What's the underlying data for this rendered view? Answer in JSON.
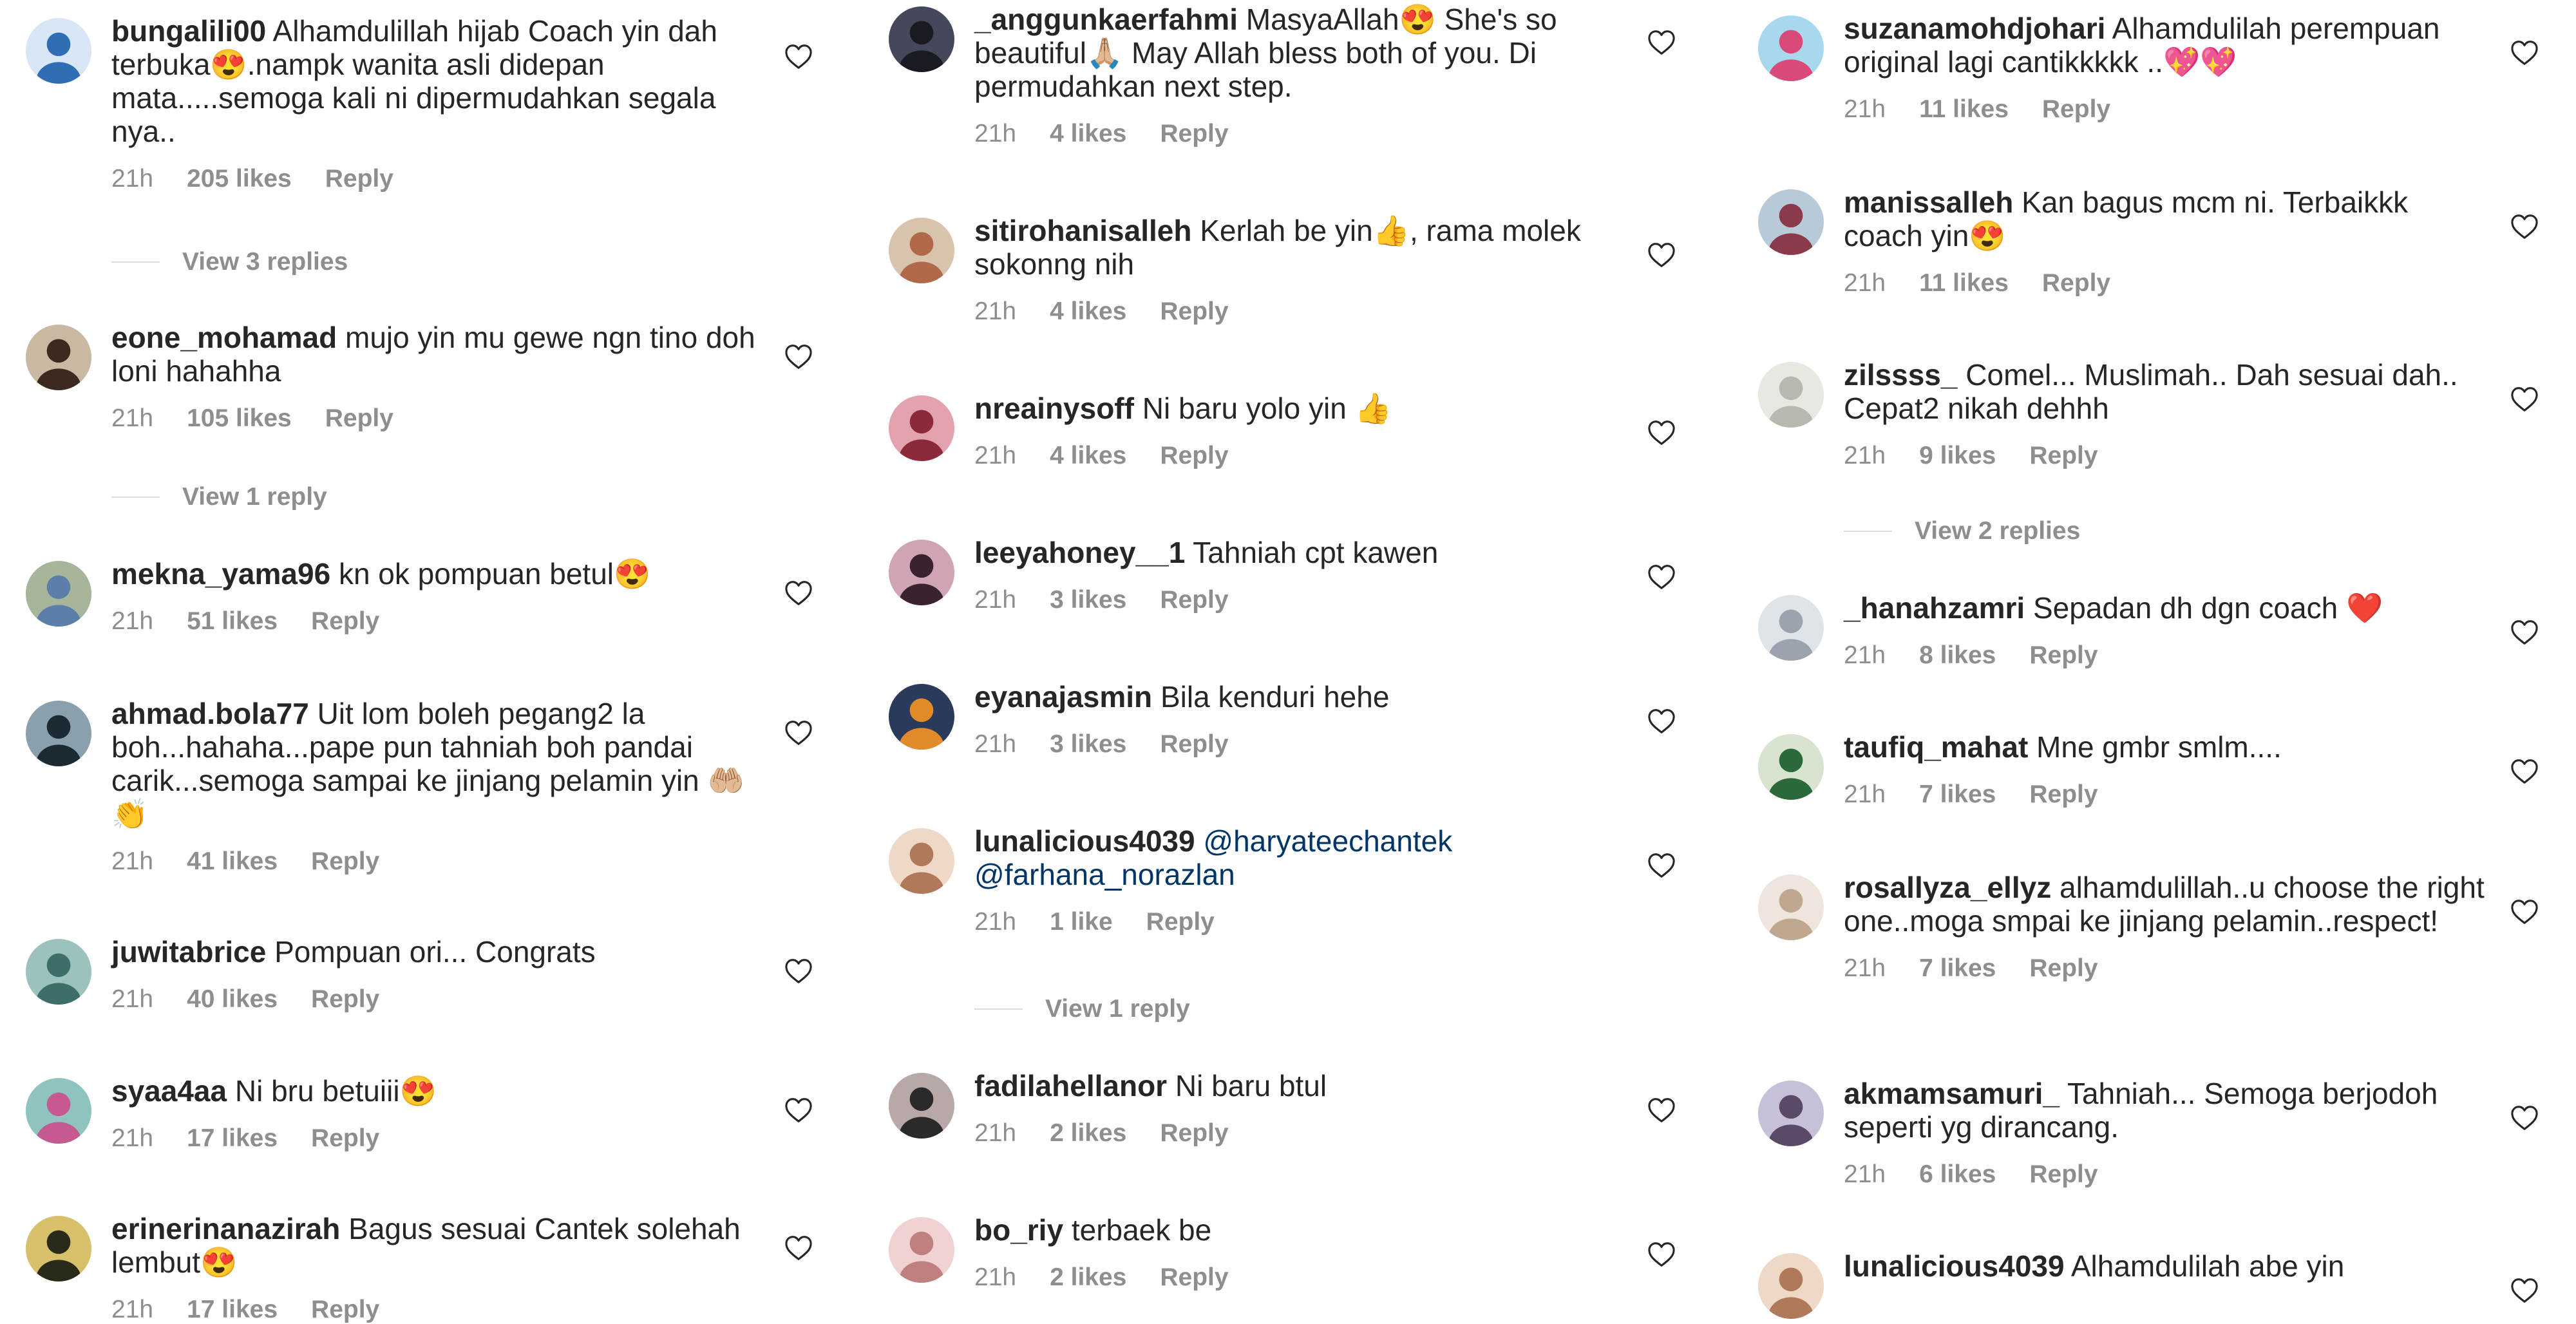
{
  "columns": [
    {
      "comments": [
        {
          "username": "bungalili00",
          "text": "Alhamdulillah hijab Coach yin dah terbuka😍.nampk wanita asli didepan mata.....semoga kali ni dipermudahkan segala nya..",
          "time": "21h",
          "likes": "205 likes",
          "reply": "Reply",
          "avatar_color": "#2f6db5",
          "avatar_bg": "#d8e6f5"
        },
        {
          "username": "eone_mohamad",
          "text": "mujo yin mu gewe ngn tino doh loni hahahha",
          "time": "21h",
          "likes": "105 likes",
          "reply": "Reply",
          "avatar_color": "#3a2a20",
          "avatar_bg": "#c9b8a2"
        },
        {
          "username": "mekna_yama96",
          "text": "kn ok pompuan betul😍",
          "time": "21h",
          "likes": "51 likes",
          "reply": "Reply",
          "avatar_color": "#5b7fa8",
          "avatar_bg": "#a7b59a"
        },
        {
          "username": "ahmad.bola77",
          "text": "Uit lom boleh pegang2 la boh...hahaha...pape pun tahniah boh pandai carik...semoga sampai ke jinjang pelamin yin 🤲🏼👏",
          "time": "21h",
          "likes": "41 likes",
          "reply": "Reply",
          "avatar_color": "#1b2a33",
          "avatar_bg": "#8aa0ad"
        },
        {
          "username": "juwitabrice",
          "text": "Pompuan ori... Congrats",
          "time": "21h",
          "likes": "40 likes",
          "reply": "Reply",
          "avatar_color": "#3d6e6a",
          "avatar_bg": "#9cc2bd"
        },
        {
          "username": "syaa4aa",
          "text": "Ni bru betuiii😍",
          "time": "21h",
          "likes": "17 likes",
          "reply": "Reply",
          "avatar_color": "#c45a8f",
          "avatar_bg": "#8fc3c0"
        },
        {
          "username": "erinerinanazirah",
          "text": "Bagus sesuai Cantek solehah lembut😍",
          "time": "21h",
          "likes": "17 likes",
          "reply": "Reply",
          "avatar_color": "#2a2a1a",
          "avatar_bg": "#d8c06a"
        }
      ],
      "view_replies": [
        "View 3 replies",
        "View 1 reply"
      ]
    },
    {
      "comments": [
        {
          "username": "_anggunkaerfahmi",
          "text": "MasyaAllah😍 She's so beautiful🙏🏼 May Allah bless both of you. Di permudahkan next step.",
          "time": "21h",
          "likes": "4 likes",
          "reply": "Reply",
          "avatar_color": "#1a1a22",
          "avatar_bg": "#44485a"
        },
        {
          "username": "sitirohanisalleh",
          "text": "Kerlah be yin👍, rama molek sokonng nih",
          "time": "21h",
          "likes": "4 likes",
          "reply": "Reply",
          "avatar_color": "#b06a4a",
          "avatar_bg": "#d9c3ad"
        },
        {
          "username": "nreainysoff",
          "text": "Ni baru yolo yin 👍",
          "time": "21h",
          "likes": "4 likes",
          "reply": "Reply",
          "avatar_color": "#8a2a3a",
          "avatar_bg": "#e3a3ae"
        },
        {
          "username": "leeyahoney__1",
          "text": "Tahniah cpt kawen",
          "time": "21h",
          "likes": "3 likes",
          "reply": "Reply",
          "avatar_color": "#3a2230",
          "avatar_bg": "#cfa4b4"
        },
        {
          "username": "eyanajasmin",
          "text": "Bila kenduri hehe",
          "time": "21h",
          "likes": "3 likes",
          "reply": "Reply",
          "avatar_color": "#e08a2a",
          "avatar_bg": "#2a3a5a"
        },
        {
          "username": "lunalicious4039",
          "text": "",
          "mentions": [
            "@haryateechantek",
            "@farhana_norazlan"
          ],
          "time": "21h",
          "likes": "1 like",
          "reply": "Reply",
          "avatar_color": "#b07a5a",
          "avatar_bg": "#efd9c6"
        },
        {
          "username": "fadilahellanor",
          "text": "Ni baru btul",
          "time": "21h",
          "likes": "2 likes",
          "reply": "Reply",
          "avatar_color": "#2a2a2a",
          "avatar_bg": "#b8a8a8"
        },
        {
          "username": "bo_riy",
          "text": "terbaek be",
          "time": "21h",
          "likes": "2 likes",
          "reply": "Reply",
          "avatar_color": "#c08080",
          "avatar_bg": "#f0d2d0"
        }
      ],
      "view_replies": [
        "View 1 reply"
      ]
    },
    {
      "comments": [
        {
          "username": "suzanamohdjohari",
          "text": "Alhamdulilah perempuan original lagi cantikkkkk ..💖💖",
          "time": "21h",
          "likes": "11 likes",
          "reply": "Reply",
          "avatar_color": "#d94a7a",
          "avatar_bg": "#a8d8ee"
        },
        {
          "username": "manissalleh",
          "text": "Kan bagus mcm ni. Terbaikkk coach yin😍",
          "time": "21h",
          "likes": "11 likes",
          "reply": "Reply",
          "avatar_color": "#8a3a4a",
          "avatar_bg": "#b8cad8"
        },
        {
          "username": "zilssss_",
          "text": "Comel... Muslimah.. Dah sesuai dah.. Cepat2 nikah dehhh",
          "time": "21h",
          "likes": "9 likes",
          "reply": "Reply",
          "avatar_color": "#b8b8b0",
          "avatar_bg": "#e8e8e2"
        },
        {
          "username": "_hanahzamri",
          "text": "Sepadan dh dgn coach ❤️",
          "time": "21h",
          "likes": "8 likes",
          "reply": "Reply",
          "avatar_color": "#9aa4ae",
          "avatar_bg": "#dfe4e8"
        },
        {
          "username": "taufiq_mahat",
          "text": "Mne gmbr smlm....",
          "time": "21h",
          "likes": "7 likes",
          "reply": "Reply",
          "avatar_color": "#2a6a3a",
          "avatar_bg": "#d8e4d0"
        },
        {
          "username": "rosallyza_ellyz",
          "text": "alhamdulillah..u choose the right one..moga smpai ke jinjang pelamin..respect!",
          "time": "21h",
          "likes": "7 likes",
          "reply": "Reply",
          "avatar_color": "#c0a890",
          "avatar_bg": "#eee6dc"
        },
        {
          "username": "akmamsamuri_",
          "text": "Tahniah... Semoga berjodoh seperti yg dirancang.",
          "time": "21h",
          "likes": "6 likes",
          "reply": "Reply",
          "avatar_color": "#5a4a6a",
          "avatar_bg": "#c8c0d8"
        },
        {
          "username": "lunalicious4039",
          "text": "Alhamdulilah abe yin",
          "time": "",
          "likes": "",
          "reply": "",
          "avatar_color": "#b07a5a",
          "avatar_bg": "#efd9c6"
        }
      ],
      "view_replies": [
        "View 2 replies"
      ]
    }
  ],
  "icons": {
    "like": "heart-outline-icon"
  },
  "colors": {
    "text": "#262626",
    "meta": "#8e8e8e",
    "mention": "#003569",
    "divider": "#dbdbdb",
    "heart_stroke": "#262626"
  }
}
